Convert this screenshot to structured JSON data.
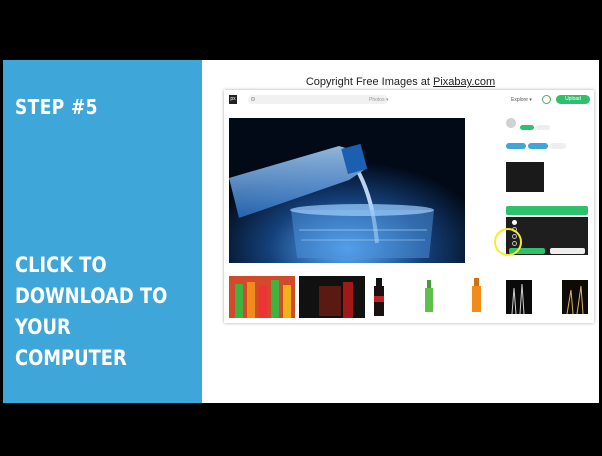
{
  "slide": {
    "step_title": "STEP #5",
    "description_lines": [
      "CLICK TO",
      "DOWNLOAD TO",
      "YOUR",
      "COMPUTER"
    ],
    "header_prefix": "Copyright Free Images at ",
    "header_link": "Pixabay.com",
    "colors": {
      "panel": "#3ea6d8",
      "accent_green": "#2ec06a",
      "cursor_highlight": "#f3ee2a"
    }
  },
  "browser": {
    "logo": "px",
    "search_placeholder": "Search",
    "photos_dropdown": "Photos ▾",
    "explore": "Explore ▾",
    "upload_label": "Upload",
    "icons": [
      "search-icon",
      "user-icon"
    ]
  }
}
